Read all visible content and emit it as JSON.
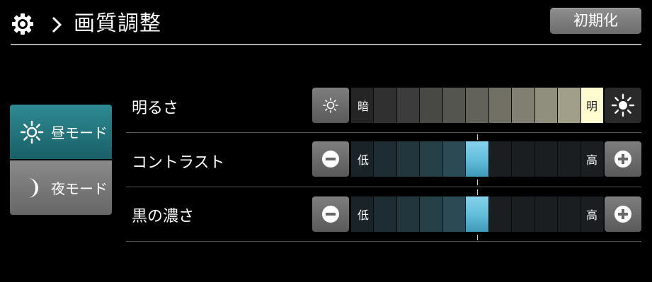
{
  "header": {
    "title": "画質調整",
    "reset_label": "初期化"
  },
  "modes": [
    {
      "label": "昼モード",
      "icon": "sun-icon",
      "active": true
    },
    {
      "label": "夜モード",
      "icon": "moon-icon",
      "active": false
    }
  ],
  "rows": [
    {
      "label": "明るさ",
      "low_label": "暗",
      "high_label": "明",
      "left_icon": "sun-small-icon",
      "right_icon": "sun-large-icon"
    },
    {
      "label": "コントラスト",
      "low_label": "低",
      "high_label": "高",
      "left_icon": "minus-icon",
      "right_icon": "plus-icon"
    },
    {
      "label": "黒の濃さ",
      "low_label": "低",
      "high_label": "高",
      "left_icon": "minus-icon",
      "right_icon": "plus-icon"
    }
  ],
  "levels": {
    "brightness": 10,
    "contrast": 5,
    "black_level": 5,
    "segments": 11
  },
  "colors": {
    "accent": "#1e8a93",
    "active_segment": "#63bfdc",
    "bright_highlight": "#fffccf"
  }
}
